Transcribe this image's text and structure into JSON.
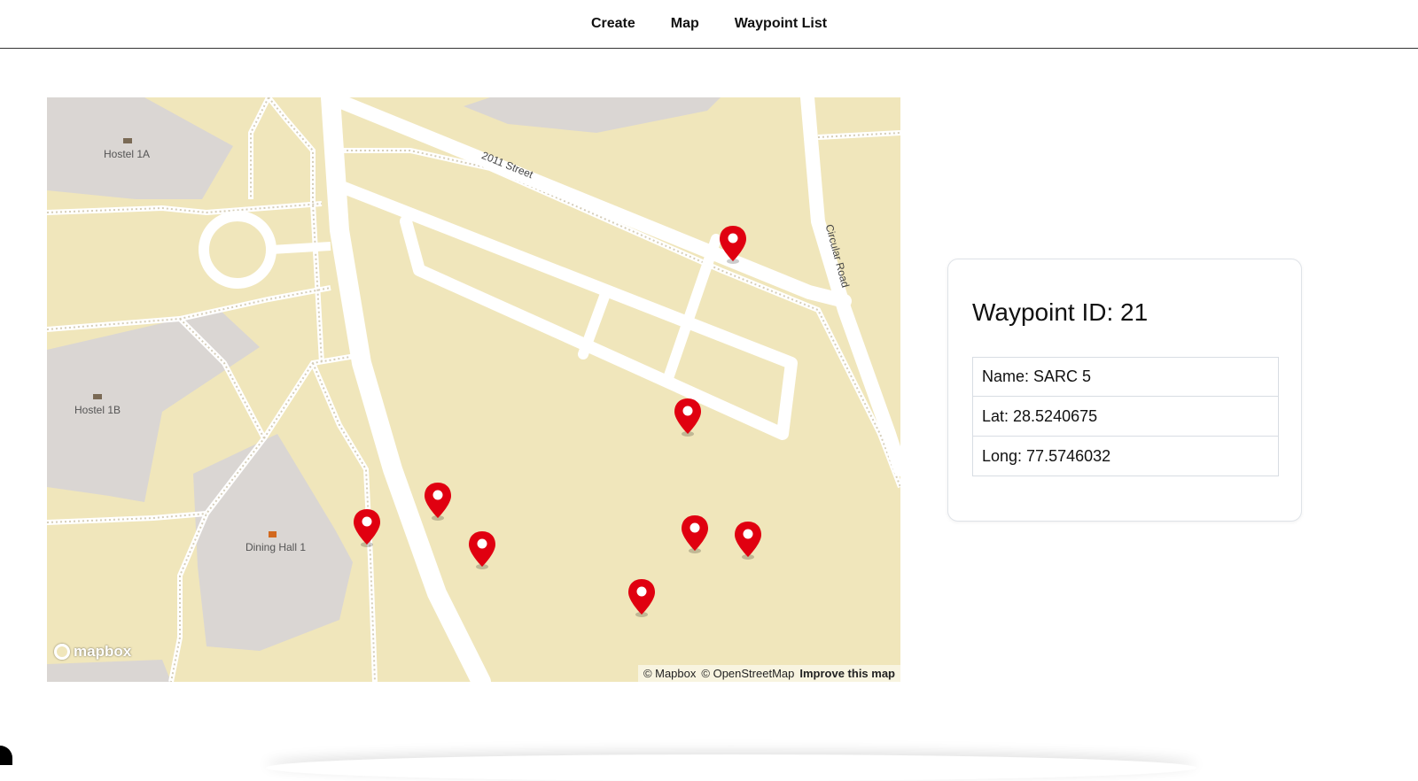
{
  "nav": {
    "create": "Create",
    "map": "Map",
    "waypoint_list": "Waypoint List"
  },
  "map": {
    "labels": {
      "hostel_1a": "Hostel 1A",
      "hostel_1b": "Hostel 1B",
      "dining_hall": "Dining Hall 1",
      "street_2011": "2011 Street",
      "circular_road": "Circular Road"
    },
    "logo": "mapbox",
    "attribution": {
      "mapbox": "© Mapbox",
      "osm": "© OpenStreetMap",
      "improve": "Improve this map"
    },
    "pin_color": "#e00010",
    "land_color": "#f0e6bb",
    "building_color": "#dad6d3"
  },
  "waypoint": {
    "title": "Waypoint ID: 21",
    "name": "Name: SARC 5",
    "lat": "Lat: 28.5240675",
    "long": "Long: 77.5746032"
  }
}
